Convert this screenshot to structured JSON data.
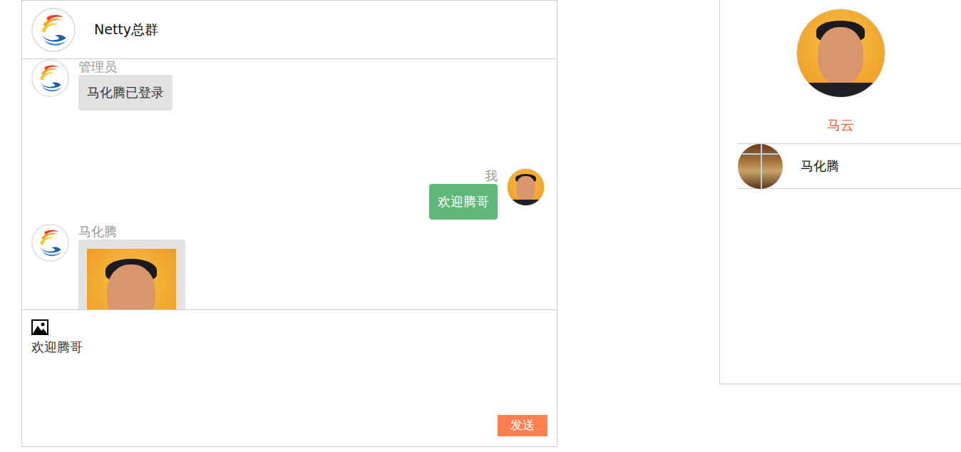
{
  "group": {
    "name": "Netty总群"
  },
  "messages": [
    {
      "sender": "管理员",
      "kind": "text",
      "text": "马化腾已登录",
      "mine": false
    },
    {
      "sender": "我",
      "kind": "text",
      "text": "欢迎腾哥",
      "mine": true
    },
    {
      "sender": "马化腾",
      "kind": "image",
      "mine": false
    }
  ],
  "composer": {
    "value": "欢迎腾哥",
    "send": "发送"
  },
  "profile": {
    "name": "马云"
  },
  "friends": [
    {
      "name": "马化腾"
    }
  ]
}
